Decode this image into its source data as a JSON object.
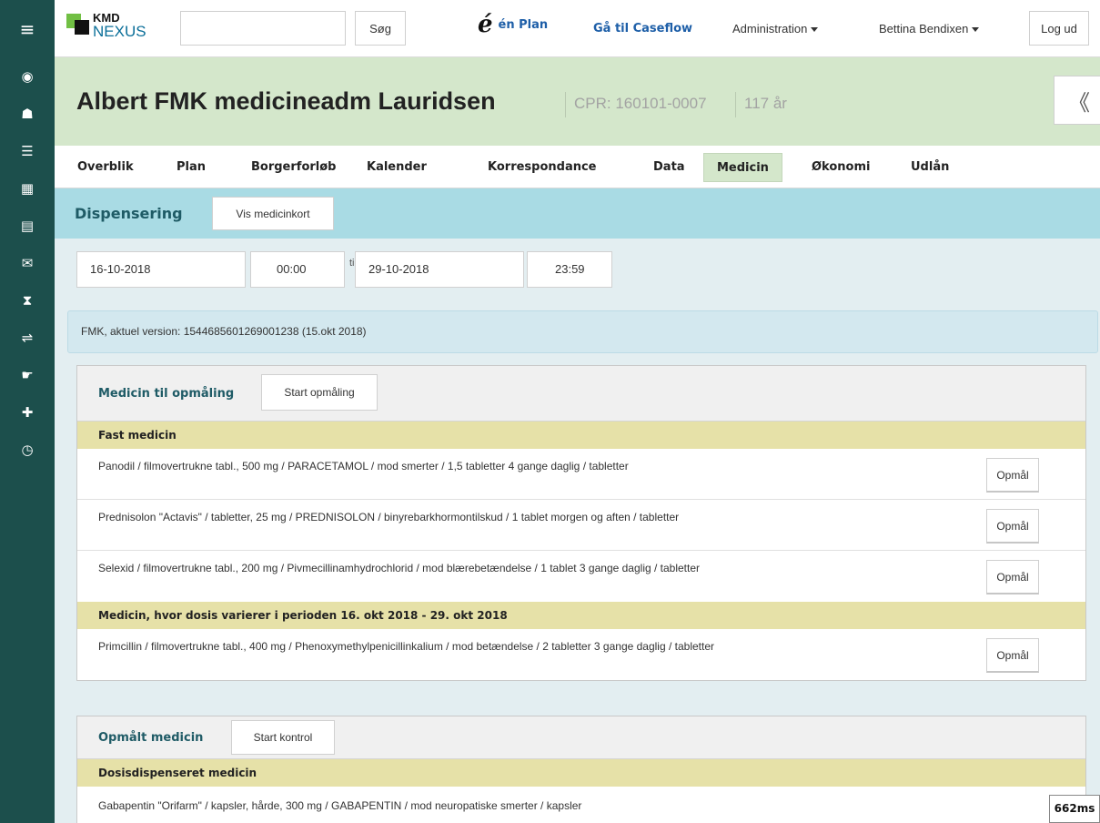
{
  "sidebar": {
    "items": [
      {
        "icon": "menu-icon",
        "glyph": "≡"
      },
      {
        "icon": "eye-icon",
        "glyph": "◉"
      },
      {
        "icon": "user-icon",
        "glyph": "☗"
      },
      {
        "icon": "list-icon",
        "glyph": "☰"
      },
      {
        "icon": "calendar-icon",
        "glyph": "▦"
      },
      {
        "icon": "clipboard-icon",
        "glyph": "▤"
      },
      {
        "icon": "mail-icon",
        "glyph": "✉"
      },
      {
        "icon": "hourglass-icon",
        "glyph": "⧗"
      },
      {
        "icon": "usb-icon",
        "glyph": "⇌"
      },
      {
        "icon": "hand-icon",
        "glyph": "☛"
      },
      {
        "icon": "medkit-icon",
        "glyph": "✚"
      },
      {
        "icon": "stopwatch-icon",
        "glyph": "◷"
      }
    ]
  },
  "topnav": {
    "logo_kmd": "KMD",
    "logo_nexus": "NEXUS",
    "search_button": "Søg",
    "enplan_glyph": "é",
    "enplan_label": "én Plan",
    "caseflow_link": "Gå til Caseflow",
    "admin_menu": "Administration",
    "user_menu": "Bettina Bendixen",
    "logout_button": "Log ud"
  },
  "patient": {
    "name": "Albert FMK medicineadm Lauridsen",
    "cpr": "CPR: 160101-0007",
    "age": "117 år",
    "collapse_glyph": "《"
  },
  "tabs": [
    {
      "label": "Overblik"
    },
    {
      "label": "Plan"
    },
    {
      "label": "Borgerforløb"
    },
    {
      "label": "Kalender"
    },
    {
      "label": "Korrespondance"
    },
    {
      "label": "Data"
    },
    {
      "label": "Medicin",
      "active": true
    },
    {
      "label": "Økonomi"
    },
    {
      "label": "Udlån"
    }
  ],
  "dispensering": {
    "title": "Dispensering",
    "vis_button": "Vis medicinkort"
  },
  "daterange": {
    "from_date": "16-10-2018",
    "from_time": "00:00",
    "til": "til",
    "to_date": "29-10-2018",
    "to_time": "23:59"
  },
  "fmk_info": "FMK, aktuel version: 1544685601269001238 (15.okt  2018)",
  "panel_opmaaling": {
    "title": "Medicin til opmåling",
    "button": "Start opmåling",
    "sections": [
      {
        "title": "Fast medicin",
        "rows": [
          {
            "desc": "Panodil / filmovertrukne tabl., 500 mg / PARACETAMOL / mod smerter / 1,5 tabletter 4 gange daglig / tabletter",
            "button": "Opmål"
          },
          {
            "desc": "Prednisolon \"Actavis\" / tabletter, 25 mg / PREDNISOLON / binyrebarkhormontilskud / 1 tablet morgen og aften / tabletter",
            "button": "Opmål"
          },
          {
            "desc": "Selexid / filmovertrukne tabl., 200 mg / Pivmecillinamhydrochlorid / mod blærebetændelse / 1 tablet 3 gange daglig / tabletter",
            "button": "Opmål"
          }
        ]
      },
      {
        "title": "Medicin, hvor dosis varierer i perioden 16. okt 2018 - 29. okt 2018",
        "rows": [
          {
            "desc": "Primcillin / filmovertrukne tabl., 400 mg / Phenoxymethylpenicillinkalium / mod betændelse / 2 tabletter 3 gange daglig / tabletter",
            "button": "Opmål"
          }
        ]
      }
    ]
  },
  "panel_opmaalt": {
    "title": "Opmålt medicin",
    "button": "Start kontrol",
    "section_title": "Dosisdispenseret medicin",
    "row_desc": "Gabapentin \"Orifarm\" / kapsler, hårde, 300 mg / GABAPENTIN / mod neuropatiske smerter / kapsler"
  },
  "timing_badge": "662ms"
}
